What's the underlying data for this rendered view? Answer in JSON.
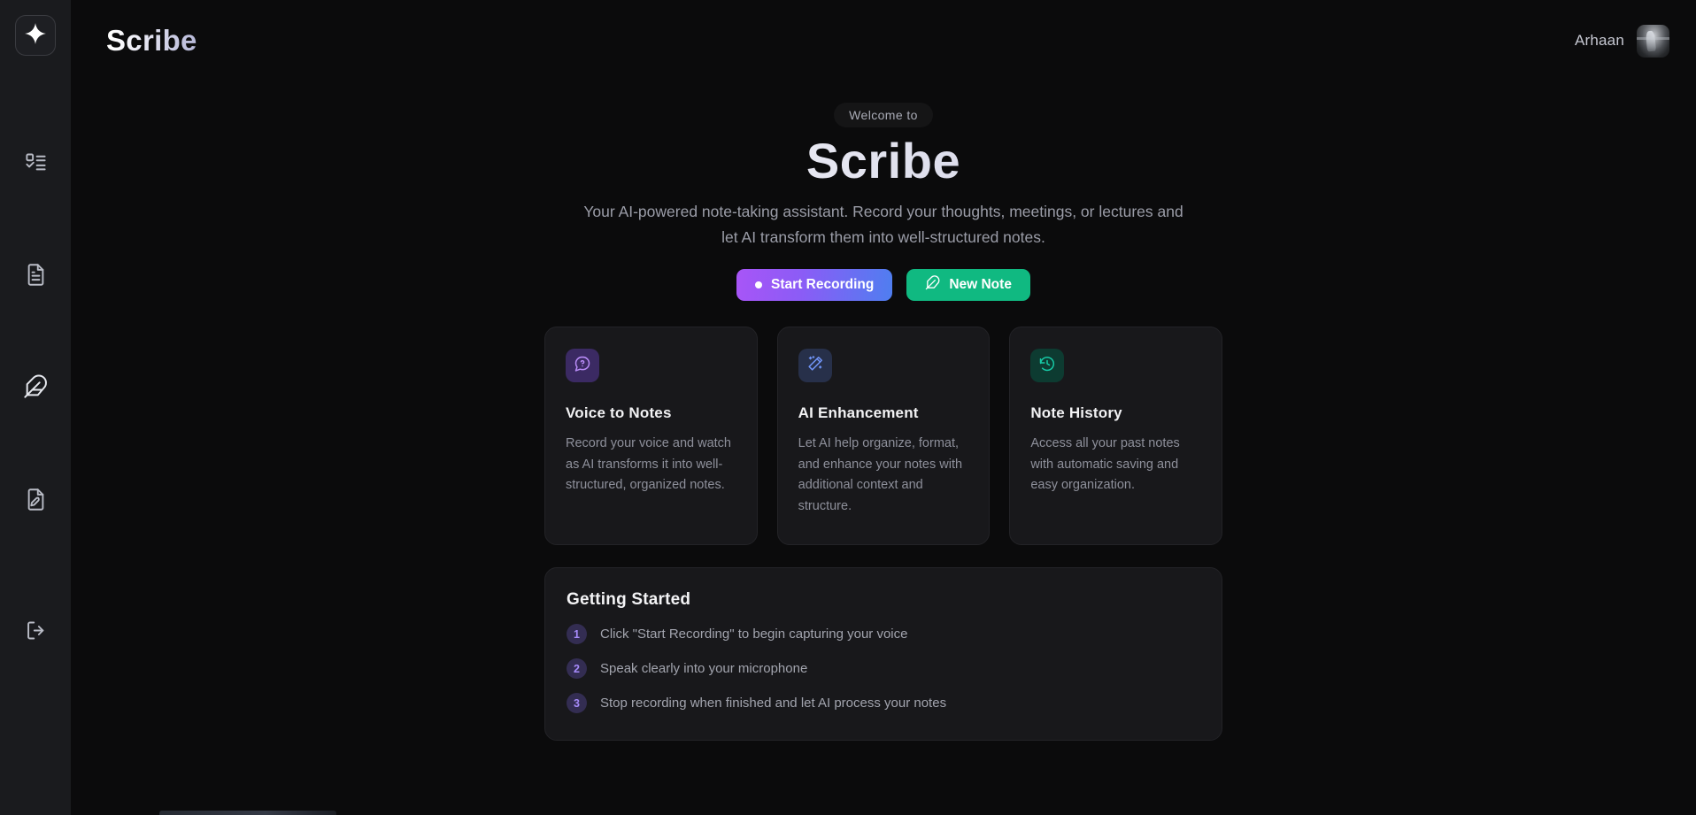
{
  "app": {
    "brand": "Scribe",
    "logo_icon": "sparkle-star-icon"
  },
  "sidebar": {
    "items": [
      {
        "icon": "list-checklist-icon",
        "name": "notes-list"
      },
      {
        "icon": "file-text-icon",
        "name": "documents"
      },
      {
        "icon": "feather-pen-icon",
        "name": "compose"
      },
      {
        "icon": "file-pen-icon",
        "name": "edit-document"
      }
    ],
    "logout": {
      "icon": "logout-arrow-icon",
      "name": "logout"
    }
  },
  "topbar": {
    "user_name": "Arhaan",
    "avatar_icon": "user-avatar-photo"
  },
  "hero": {
    "eyebrow": "Welcome to",
    "title": "Scribe",
    "subtitle": "Your AI-powered note-taking assistant. Record your thoughts, meetings, or lectures and let AI transform them into well-structured notes.",
    "buttons": [
      {
        "label": "Start Recording",
        "icon": "record-dot-icon",
        "style": "gradient-purple-blue"
      },
      {
        "label": "New Note",
        "icon": "feather-pen-icon",
        "style": "solid-green"
      }
    ]
  },
  "features": [
    {
      "icon": "message-question-icon",
      "icon_tone": "purple",
      "title": "Voice to Notes",
      "description": "Record your voice and watch as AI transforms it into well-structured, organized notes."
    },
    {
      "icon": "magic-wand-sparkles-icon",
      "icon_tone": "blue",
      "title": "AI Enhancement",
      "description": "Let AI help organize, format, and enhance your notes with additional context and structure."
    },
    {
      "icon": "clock-rotate-left-icon",
      "icon_tone": "teal",
      "title": "Note History",
      "description": "Access all your past notes with automatic saving and easy organization."
    }
  ],
  "getting_started": {
    "title": "Getting Started",
    "steps": [
      {
        "number": "1",
        "text": "Click \"Start Recording\" to begin capturing your voice"
      },
      {
        "number": "2",
        "text": "Speak clearly into your microphone"
      },
      {
        "number": "3",
        "text": "Stop recording when finished and let AI process your notes"
      }
    ]
  },
  "colors": {
    "accent_purple": "#a855f7",
    "accent_blue": "#4f7ef0",
    "accent_green": "#10b981",
    "accent_teal": "#14b8a6",
    "background": "#0b0b0c",
    "sidebar_background": "#1a1b1e",
    "card_background": "#18181b"
  }
}
